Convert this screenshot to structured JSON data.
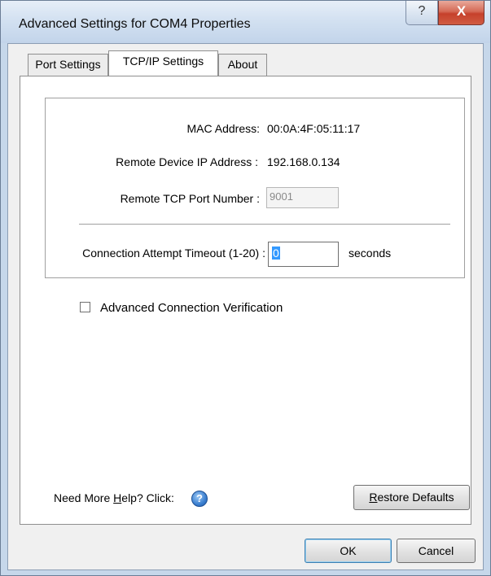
{
  "window": {
    "title": "Advanced Settings for COM4 Properties",
    "help_glyph": "?",
    "close_glyph": "X"
  },
  "tabs": [
    {
      "label": "Port Settings",
      "active": false
    },
    {
      "label": "TCP/IP Settings",
      "active": true
    },
    {
      "label": "About",
      "active": false
    }
  ],
  "tcpip": {
    "mac_label": "MAC Address:",
    "mac_value": "00:0A:4F:05:11:17",
    "remote_ip_label": "Remote Device IP Address :",
    "remote_ip_value": "192.168.0.134",
    "remote_port_label": "Remote TCP Port Number :",
    "remote_port_value": "9001",
    "timeout_label": "Connection Attempt Timeout (1-20) :",
    "timeout_value": "0",
    "timeout_unit": "seconds"
  },
  "verification": {
    "label": "Advanced Connection Verification",
    "checked": false
  },
  "help": {
    "prefix": "Need More ",
    "hotkey": "H",
    "suffix": "elp? Click:",
    "icon": "help-icon",
    "icon_glyph": "?"
  },
  "buttons": {
    "restore_hotkey": "R",
    "restore_rest": "estore Defaults",
    "ok": "OK",
    "cancel": "Cancel"
  },
  "colors": {
    "frame": "#c6d7ea",
    "close": "#c6402b",
    "selection": "#3399ff"
  }
}
